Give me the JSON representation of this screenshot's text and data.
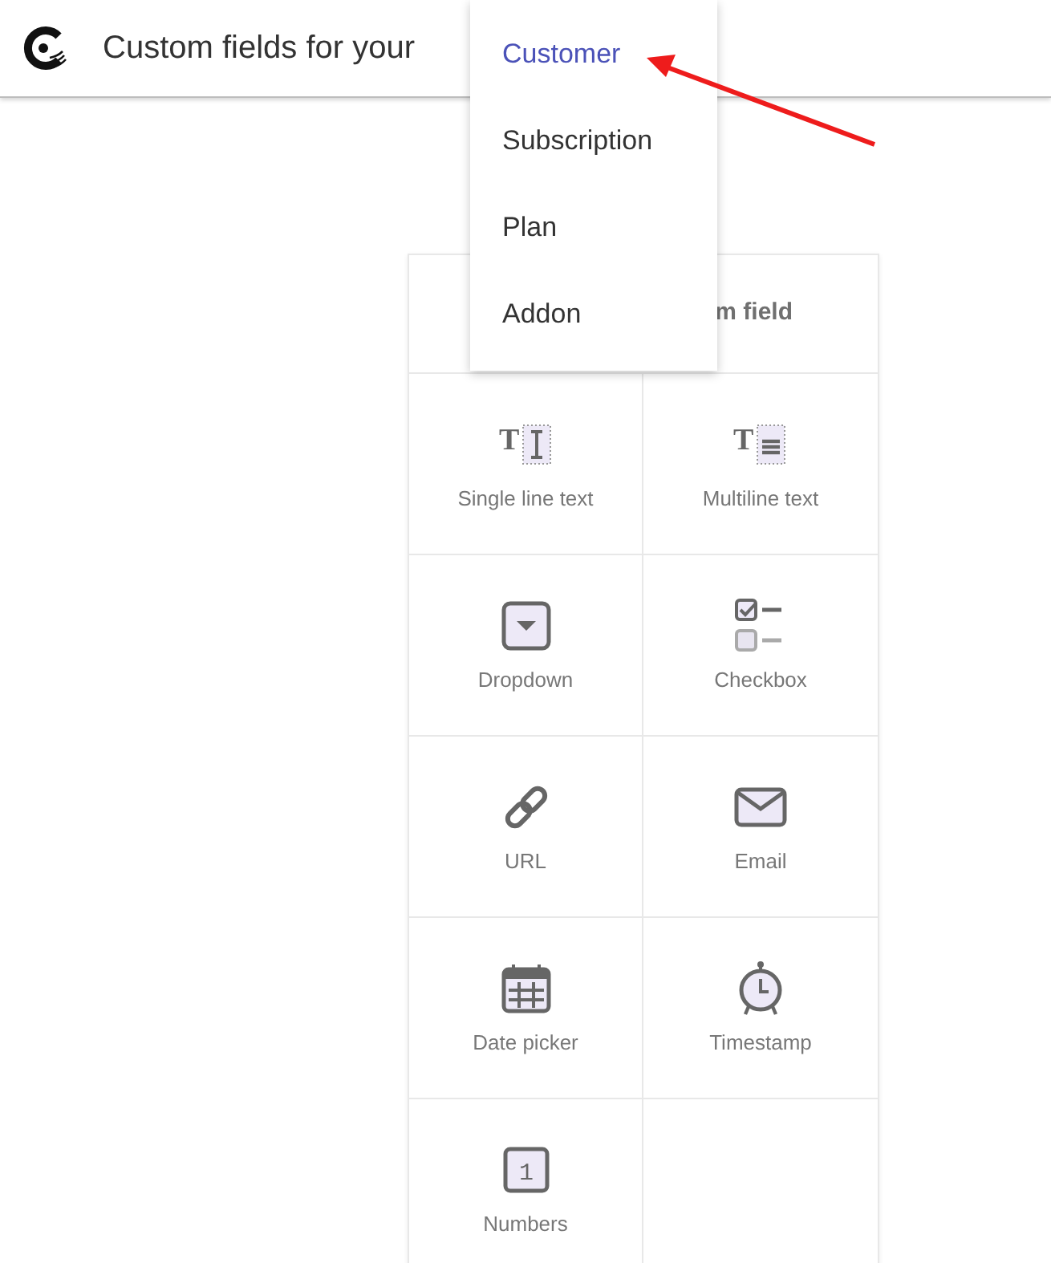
{
  "header": {
    "title": "Custom fields for your"
  },
  "menu": {
    "items": [
      {
        "label": "Customer",
        "selected": true
      },
      {
        "label": "Subscription",
        "selected": false
      },
      {
        "label": "Plan",
        "selected": false
      },
      {
        "label": "Addon",
        "selected": false
      }
    ]
  },
  "card": {
    "title": "m field",
    "fields": [
      {
        "kind": "single_line",
        "label": "Single line text",
        "glyph": "T"
      },
      {
        "kind": "multiline",
        "label": "Multiline text",
        "glyph": "T"
      },
      {
        "kind": "dropdown",
        "label": "Dropdown"
      },
      {
        "kind": "checkbox",
        "label": "Checkbox"
      },
      {
        "kind": "url",
        "label": "URL"
      },
      {
        "kind": "email",
        "label": "Email"
      },
      {
        "kind": "date",
        "label": "Date picker"
      },
      {
        "kind": "timestamp",
        "label": "Timestamp"
      },
      {
        "kind": "number",
        "label": "Numbers",
        "glyph": "1"
      }
    ]
  }
}
